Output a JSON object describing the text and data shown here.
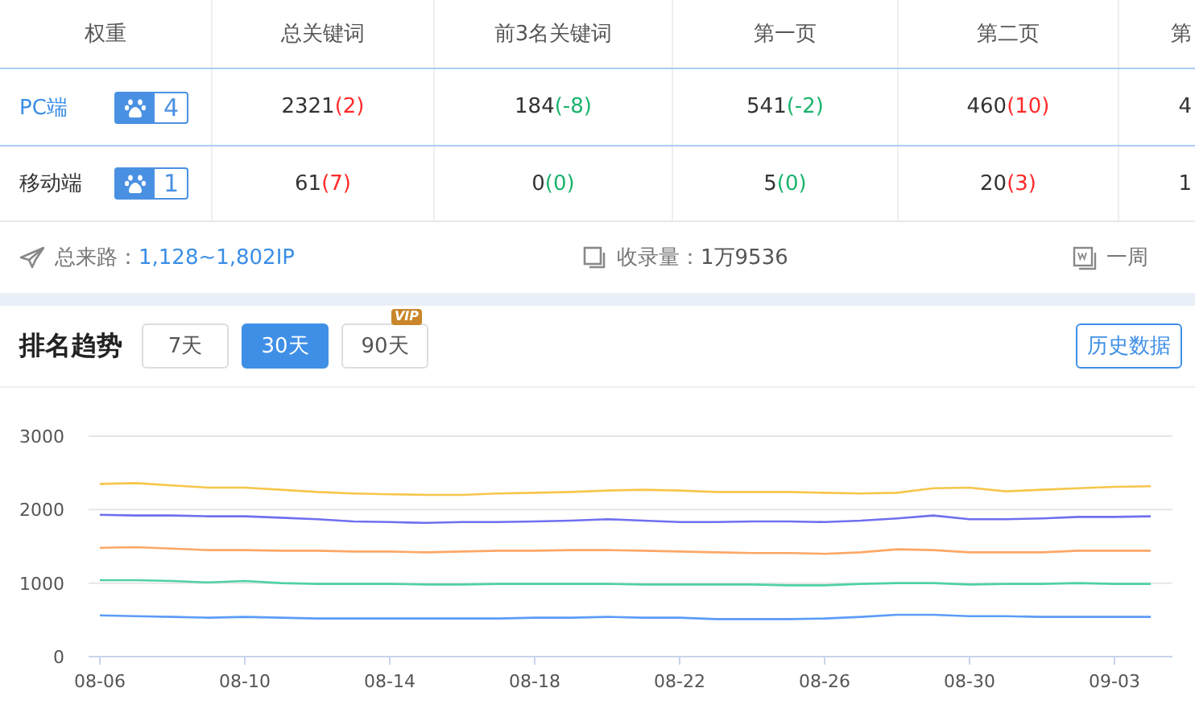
{
  "table": {
    "columns": [
      "权重",
      "总关键词",
      "前3名关键词",
      "第一页",
      "第二页",
      "第"
    ],
    "rows": [
      {
        "cells": [
          {
            "platform": "PC端",
            "kind": "link",
            "rank": "4"
          },
          {
            "value": "2321",
            "delta": "(2)",
            "color": "#ff2a2a"
          },
          {
            "value": "184",
            "delta": "(-8)",
            "color": "#19b36b"
          },
          {
            "value": "541",
            "delta": "(-2)",
            "color": "#19b36b"
          },
          {
            "value": "460",
            "delta": "(10)",
            "color": "#ff2a2a"
          },
          {
            "value": "4"
          }
        ]
      },
      {
        "cells": [
          {
            "platform": "移动端",
            "kind": "plain",
            "rank": "1"
          },
          {
            "value": "61",
            "delta": "(7)",
            "color": "#ff2a2a"
          },
          {
            "value": "0",
            "delta": "(0)",
            "color": "#19b36b"
          },
          {
            "value": "5",
            "delta": "(0)",
            "color": "#19b36b"
          },
          {
            "value": "20",
            "delta": "(3)",
            "color": "#ff2a2a"
          },
          {
            "value": "1"
          }
        ]
      }
    ]
  },
  "stats": [
    {
      "label": "总来路：",
      "value": "1,128~1,802IP",
      "kind": "link"
    },
    {
      "label": "收录量：",
      "value": "1万9536",
      "kind": "plain"
    },
    {
      "label": "一周"
    }
  ],
  "trend": {
    "title": "排名趋势",
    "ranges": [
      {
        "label": "7天",
        "selected": false
      },
      {
        "label": "30天",
        "selected": true
      },
      {
        "label": "90天",
        "selected": false,
        "badge": "VIP"
      }
    ],
    "history_button": "历史数据",
    "chart_data": {
      "type": "line",
      "categories": [
        "08-06",
        null,
        null,
        null,
        "08-10",
        null,
        null,
        null,
        "08-14",
        null,
        null,
        null,
        "08-18",
        null,
        null,
        null,
        "08-22",
        null,
        null,
        null,
        "08-26",
        null,
        null,
        null,
        "08-30",
        null,
        null,
        null,
        "09-03",
        null
      ],
      "yticks": [
        0,
        1000,
        2000,
        3000
      ],
      "ylim": [
        0,
        3000
      ],
      "series": [
        {
          "color": "#f7c64a",
          "values": [
            2350,
            2360,
            2330,
            2300,
            2300,
            2270,
            2240,
            2220,
            2210,
            2200,
            2200,
            2220,
            2230,
            2240,
            2260,
            2270,
            2260,
            2240,
            2240,
            2240,
            2230,
            2220,
            2230,
            2290,
            2300,
            2250,
            2270,
            2290,
            2310,
            2320
          ]
        },
        {
          "color": "#6f6ff0",
          "values": [
            1930,
            1920,
            1920,
            1910,
            1910,
            1890,
            1870,
            1840,
            1830,
            1820,
            1830,
            1830,
            1840,
            1850,
            1870,
            1850,
            1830,
            1830,
            1840,
            1840,
            1830,
            1850,
            1880,
            1920,
            1870,
            1870,
            1880,
            1900,
            1900,
            1910
          ]
        },
        {
          "color": "#fca766",
          "values": [
            1480,
            1490,
            1470,
            1450,
            1450,
            1440,
            1440,
            1430,
            1430,
            1420,
            1430,
            1440,
            1440,
            1450,
            1450,
            1440,
            1430,
            1420,
            1410,
            1410,
            1400,
            1420,
            1460,
            1450,
            1420,
            1420,
            1420,
            1440,
            1440,
            1440
          ]
        },
        {
          "color": "#4fd1a5",
          "values": [
            1040,
            1040,
            1030,
            1010,
            1030,
            1000,
            990,
            990,
            990,
            980,
            980,
            990,
            990,
            990,
            990,
            980,
            980,
            980,
            980,
            970,
            970,
            990,
            1000,
            1000,
            980,
            990,
            990,
            1000,
            990,
            990
          ]
        },
        {
          "color": "#5b9cf8",
          "values": [
            560,
            550,
            540,
            530,
            540,
            530,
            520,
            520,
            520,
            520,
            520,
            520,
            530,
            530,
            540,
            530,
            530,
            510,
            510,
            510,
            520,
            540,
            570,
            570,
            550,
            550,
            540,
            540,
            540,
            540
          ]
        }
      ]
    }
  }
}
